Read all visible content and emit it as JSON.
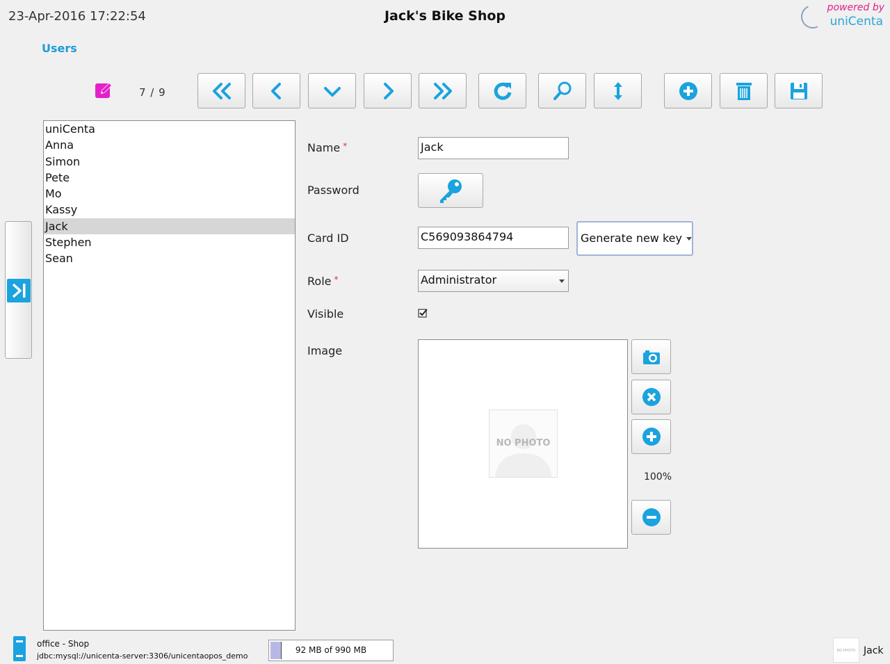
{
  "header": {
    "datetime": "23-Apr-2016 17:22:54",
    "shop_title": "Jack's Bike Shop",
    "brand_line1": "powered by",
    "brand_line2": "uniCenta"
  },
  "section_title": "Users",
  "toolbar": {
    "record_counter": "7 / 9",
    "buttons": [
      {
        "name": "first-record-button",
        "icon": "double-chevron-left-icon"
      },
      {
        "name": "previous-record-button",
        "icon": "chevron-left-icon"
      },
      {
        "name": "down-button",
        "icon": "chevron-down-icon"
      },
      {
        "name": "next-record-button",
        "icon": "chevron-right-icon"
      },
      {
        "name": "last-record-button",
        "icon": "double-chevron-right-icon"
      },
      {
        "name": "reload-button",
        "icon": "refresh-icon"
      },
      {
        "name": "search-button",
        "icon": "search-icon"
      },
      {
        "name": "sort-button",
        "icon": "sort-vertical-icon"
      },
      {
        "name": "new-record-button",
        "icon": "plus-circle-icon"
      },
      {
        "name": "delete-record-button",
        "icon": "trash-icon"
      },
      {
        "name": "save-record-button",
        "icon": "save-icon"
      }
    ]
  },
  "users": {
    "items": [
      "uniCenta",
      "Anna",
      "Simon",
      "Pete",
      "Mo",
      "Kassy",
      "Jack",
      "Stephen",
      "Sean"
    ],
    "selected": "Jack"
  },
  "form": {
    "name_label": "Name",
    "name_value": "Jack",
    "password_label": "Password",
    "card_id_label": "Card ID",
    "card_id_value": "C569093864794",
    "generate_key_label": "Generate new key",
    "role_label": "Role",
    "role_value": "Administrator",
    "visible_label": "Visible",
    "visible_checked": true,
    "image_label": "Image",
    "no_photo_text": "NO PHOTO",
    "zoom_level": "100%",
    "required_marker": "*"
  },
  "status_bar": {
    "location": "office - Shop",
    "db_url": "jdbc:mysql://unicenta-server:3306/unicentaopos_demo",
    "memory_text": "92 MB of 990 MB",
    "memory_fraction": 0.093,
    "user_thumb_text": "NO PHOTO",
    "current_user": "Jack"
  },
  "colors": {
    "accent": "#1aa3de",
    "required": "#e0208a",
    "edit_icon": "#e620c8"
  }
}
